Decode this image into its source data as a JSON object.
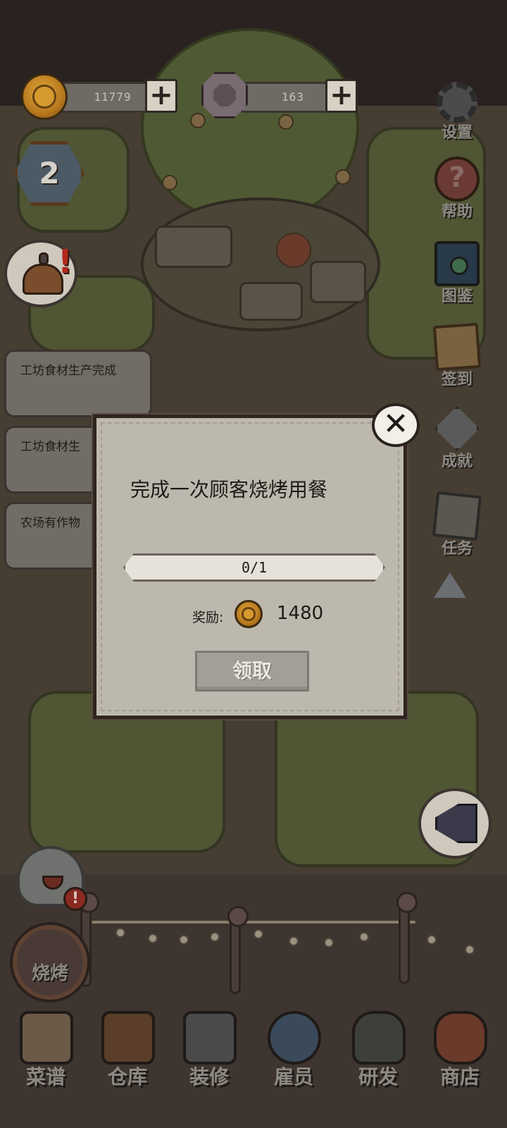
{
  "currencies": {
    "coins": "11779",
    "gems": "163",
    "plus_label": "+"
  },
  "level": "2",
  "notifications": [
    "工坊食材生产完成",
    "工坊食材生",
    "农场有作物"
  ],
  "side_menu": [
    {
      "label": "设置",
      "icon": "gear-icon"
    },
    {
      "label": "帮助",
      "icon": "question-icon"
    },
    {
      "label": "图鉴",
      "icon": "book-icon"
    },
    {
      "label": "签到",
      "icon": "scroll-icon"
    },
    {
      "label": "成就",
      "icon": "diamond-icon"
    },
    {
      "label": "任务",
      "icon": "map-icon"
    }
  ],
  "alert_mark": "!",
  "bbq_button": "烧烤",
  "dialog": {
    "task": "完成一次顾客烧烤用餐",
    "progress_text": "0/1",
    "progress": 0,
    "reward_label": "奖励:",
    "reward_amount": "1480",
    "claim_label": "领取",
    "close_label": "✕"
  },
  "bottom_nav": [
    {
      "label": "菜谱",
      "icon": "recipe-icon",
      "color": "#6b5a48"
    },
    {
      "label": "仓库",
      "icon": "warehouse-icon",
      "color": "#5a3e2a"
    },
    {
      "label": "装修",
      "icon": "hammer-icon",
      "color": "#4a4a4a"
    },
    {
      "label": "雇员",
      "icon": "employee-icon",
      "color": "#3a4a5a"
    },
    {
      "label": "研发",
      "icon": "pot-icon",
      "color": "#3e3e3a"
    },
    {
      "label": "商店",
      "icon": "shop-icon",
      "color": "#6a3a2a"
    }
  ]
}
